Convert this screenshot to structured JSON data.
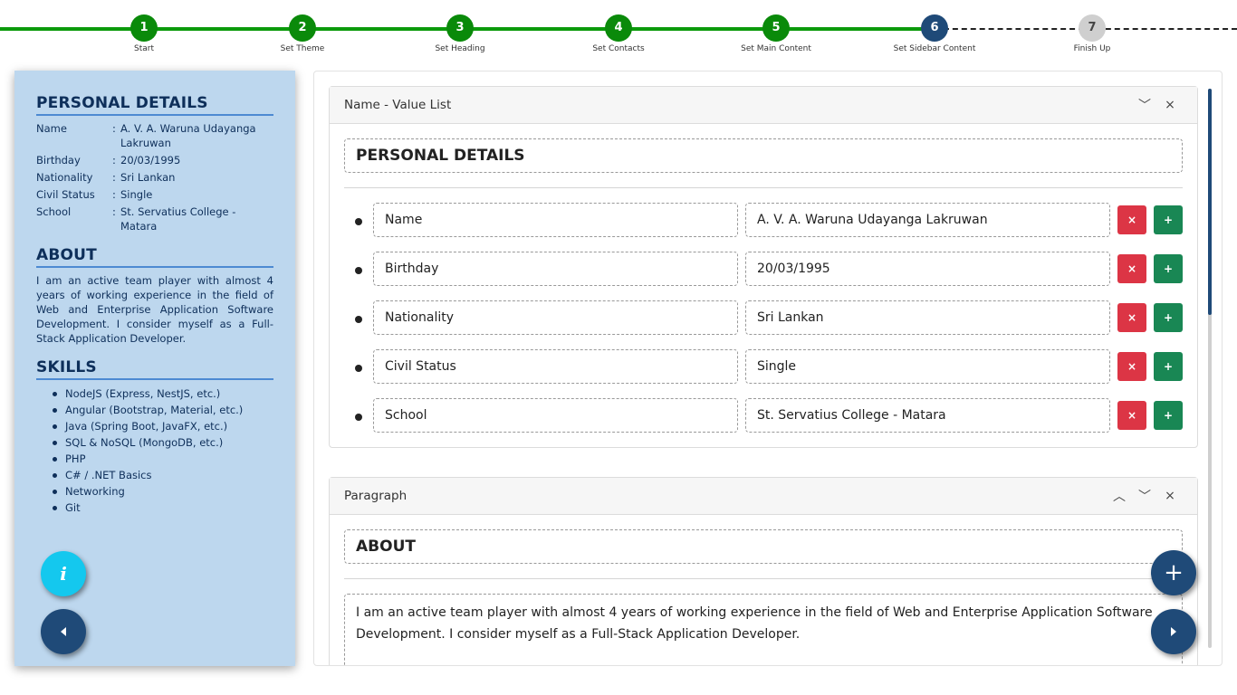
{
  "stepper": {
    "steps": [
      {
        "number": "1",
        "label": "Start",
        "state": "done"
      },
      {
        "number": "2",
        "label": "Set Theme",
        "state": "done"
      },
      {
        "number": "3",
        "label": "Set Heading",
        "state": "done"
      },
      {
        "number": "4",
        "label": "Set Contacts",
        "state": "done"
      },
      {
        "number": "5",
        "label": "Set Main Content",
        "state": "done"
      },
      {
        "number": "6",
        "label": "Set Sidebar Content",
        "state": "active"
      },
      {
        "number": "7",
        "label": "Finish Up",
        "state": "pending"
      }
    ],
    "colors": {
      "done": "#0a8a0a",
      "active": "#1f4a78",
      "pending": "#cfcfcf"
    }
  },
  "preview": {
    "personal": {
      "heading": "PERSONAL DETAILS",
      "rows": [
        {
          "name": "Name",
          "colon": ":",
          "value": "A. V. A. Waruna Udayanga Lakruwan"
        },
        {
          "name": "Birthday",
          "colon": ":",
          "value": "20/03/1995"
        },
        {
          "name": "Nationality",
          "colon": ":",
          "value": "Sri Lankan"
        },
        {
          "name": "Civil Status",
          "colon": ":",
          "value": "Single"
        },
        {
          "name": "School",
          "colon": ":",
          "value": "St. Servatius College - Matara"
        }
      ]
    },
    "about": {
      "heading": "ABOUT",
      "text": "I am an active team player with almost 4 years of working experience in the field of Web and Enterprise Application Software Development. I consider myself as a Full-Stack Application Developer."
    },
    "skills": {
      "heading": "SKILLS",
      "items": [
        "NodeJS (Express, NestJS, etc.)",
        "Angular (Bootstrap, Material, etc.)",
        "Java (Spring Boot, JavaFX, etc.)",
        "SQL & NoSQL (MongoDB, etc.)",
        "PHP",
        "C# / .NET Basics",
        "Networking",
        "Git"
      ]
    },
    "background_color": "#bdd7ee"
  },
  "fabs": {
    "info_glyph": "i",
    "add_glyph": "+",
    "info_icon": "info-icon",
    "prev_icon": "triangle-left-icon",
    "next_icon": "triangle-right-icon"
  },
  "editor": {
    "name_value_card": {
      "title": "Name - Value List",
      "collapse_glyph": "﹀",
      "close_glyph": "×",
      "heading_value": "PERSONAL DETAILS",
      "rows": [
        {
          "name": "Name",
          "value": "A. V. A. Waruna Udayanga Lakruwan"
        },
        {
          "name": "Birthday",
          "value": "20/03/1995"
        },
        {
          "name": "Nationality",
          "value": "Sri Lankan"
        },
        {
          "name": "Civil Status",
          "value": "Single"
        },
        {
          "name": "School",
          "value": "St. Servatius College - Matara"
        }
      ],
      "remove_glyph": "×",
      "add_glyph": "+"
    },
    "paragraph_card": {
      "title": "Paragraph",
      "up_glyph": "︿",
      "down_glyph": "﹀",
      "close_glyph": "×",
      "heading_value": "ABOUT",
      "paragraph_value": "I am an active team player with almost 4 years of working experience in the field of Web and Enterprise Application Software Development. I consider myself as a Full-Stack Application Developer."
    }
  }
}
